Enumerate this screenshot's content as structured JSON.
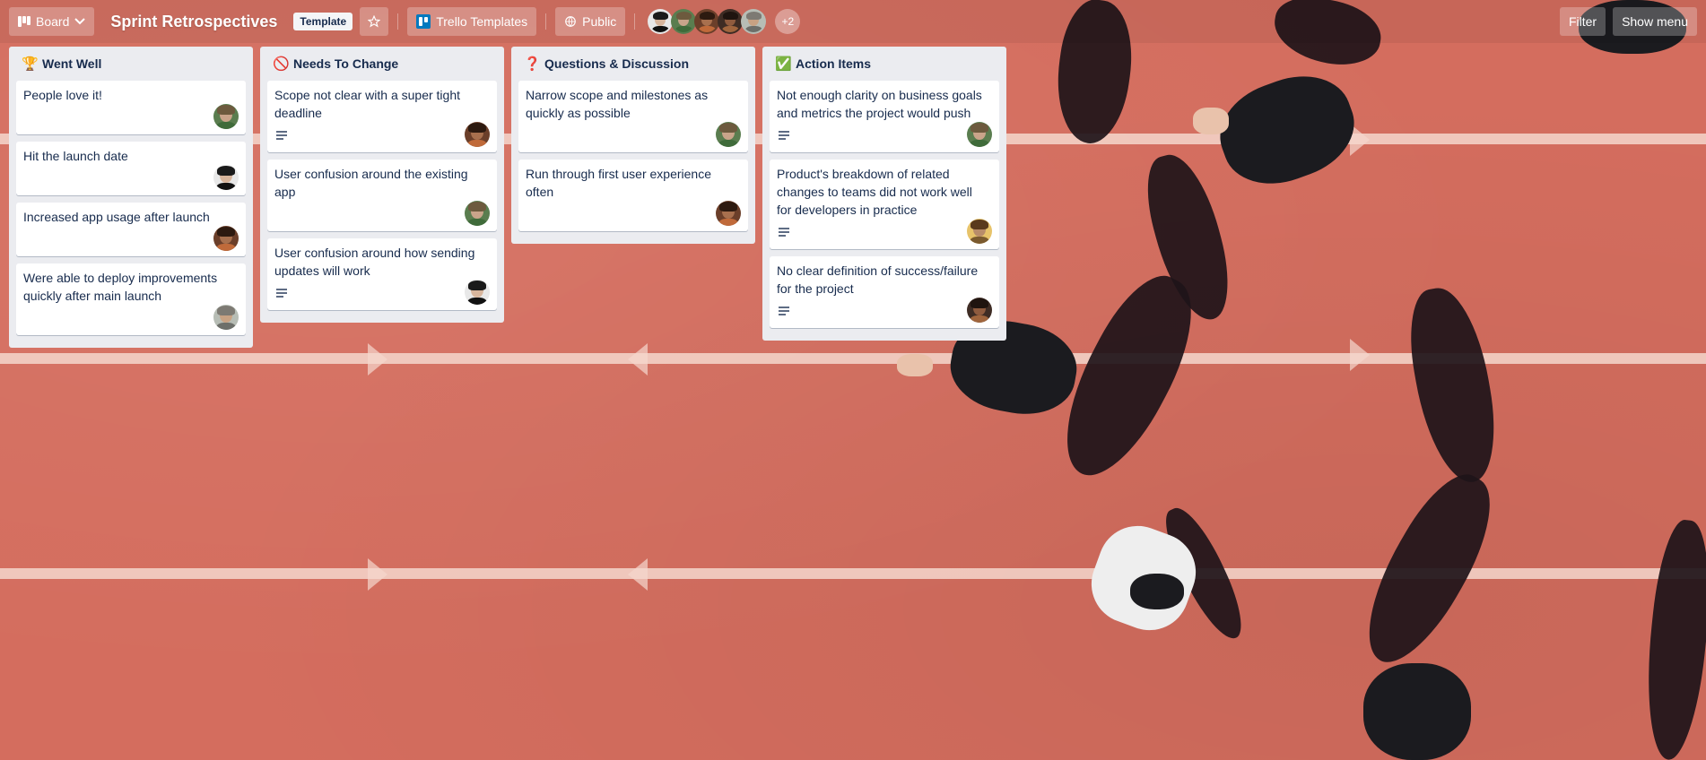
{
  "header": {
    "view_label": "Board",
    "board_title": "Sprint Retrospectives",
    "template_badge": "Template",
    "workspace_label": "Trello Templates",
    "visibility_label": "Public",
    "more_members": "+2",
    "filter_label": "Filter",
    "menu_label": "Show menu"
  },
  "lists": [
    {
      "icon": "🏆",
      "title": "Went Well",
      "cards": [
        {
          "title": "People love it!",
          "has_desc": false,
          "avatar": "green"
        },
        {
          "title": "Hit the launch date",
          "has_desc": false,
          "avatar": "dark-man"
        },
        {
          "title": "Increased app usage after launch",
          "has_desc": false,
          "avatar": "brown-curly"
        },
        {
          "title": "Were able to deploy improvements quickly after main launch",
          "has_desc": false,
          "avatar": "gray-hat"
        }
      ]
    },
    {
      "icon": "🚫",
      "title": "Needs To Change",
      "cards": [
        {
          "title": "Scope not clear with a super tight deadline",
          "has_desc": true,
          "avatar": "brown-curly"
        },
        {
          "title": "User confusion around the existing app",
          "has_desc": false,
          "avatar": "green"
        },
        {
          "title": "User confusion around how sending updates will work",
          "has_desc": true,
          "avatar": "dark-man"
        }
      ]
    },
    {
      "icon": "❓",
      "title": "Questions & Discussion",
      "cards": [
        {
          "title": "Narrow scope and milestones as quickly as possible",
          "has_desc": false,
          "avatar": "green"
        },
        {
          "title": "Run through first user experience often",
          "has_desc": false,
          "avatar": "brown-curly"
        }
      ]
    },
    {
      "icon": "✅",
      "title": "Action Items",
      "cards": [
        {
          "title": "Not enough clarity on business goals and metrics the project would push",
          "has_desc": true,
          "avatar": "green"
        },
        {
          "title": "Product's breakdown of related changes to teams did not work well for developers in practice",
          "has_desc": true,
          "avatar": "yellow-curly"
        },
        {
          "title": "No clear definition of success/failure for the project",
          "has_desc": true,
          "avatar": "brown-dark"
        }
      ]
    }
  ],
  "avatar_styles": {
    "green": {
      "bg": "#5a7d4f",
      "face": "#c9a48a",
      "hair": "#6d5a3e",
      "body": "#3f6b3a"
    },
    "dark-man": {
      "bg": "#e8e8e8",
      "face": "#d7b59c",
      "hair": "#1a1a1a",
      "body": "#111111"
    },
    "brown-curly": {
      "bg": "#6b3f2a",
      "face": "#a8704e",
      "hair": "#2d1a10",
      "body": "#c06a3a"
    },
    "gray-hat": {
      "bg": "#b7bdb5",
      "face": "#c8a283",
      "hair": "#7d7a73",
      "body": "#6d6f6a"
    },
    "yellow-curly": {
      "bg": "#e7c36a",
      "face": "#b88c6a",
      "hair": "#5a3a1c",
      "body": "#7a5a2f"
    },
    "brown-dark": {
      "bg": "#3e2c24",
      "face": "#8f5b3e",
      "hair": "#1f140f",
      "body": "#a0653d"
    }
  },
  "header_members": [
    "dark-man",
    "green",
    "brown-curly",
    "brown-dark",
    "gray-hat"
  ],
  "colors": {
    "list_bg": "#ebecf0",
    "card_text": "#172b4d",
    "workspace_logo": "#0079bf"
  },
  "icons": {
    "view": "board-icon",
    "dropdown": "chevron-down-icon",
    "star": "star-icon",
    "visibility": "globe-icon",
    "description": "description-lines-icon"
  }
}
